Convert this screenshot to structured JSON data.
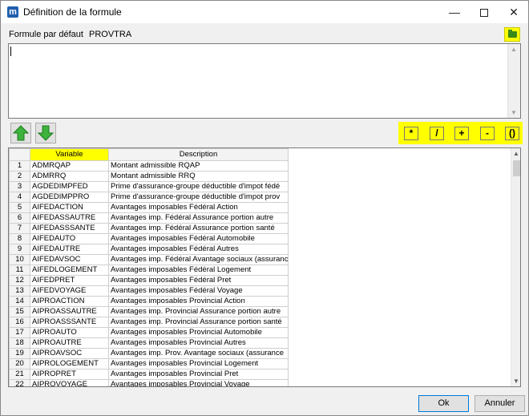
{
  "window": {
    "app_icon_letter": "m",
    "title": "Définition de la formule",
    "controls": {
      "minimize": "—",
      "close": "✕"
    }
  },
  "formula": {
    "label": "Formule par défaut",
    "name": "PROVTRA",
    "content": ""
  },
  "operators": [
    "*",
    "/",
    "+",
    "-",
    "()"
  ],
  "grid": {
    "columns": [
      "Variable",
      "Description"
    ],
    "rows": [
      {
        "n": "1",
        "variable": "ADMRQAP",
        "description": "Montant admissible RQAP"
      },
      {
        "n": "2",
        "variable": "ADMRRQ",
        "description": "Montant admissible RRQ"
      },
      {
        "n": "3",
        "variable": "AGDEDIMPFED",
        "description": "Prime d'assurance-groupe déductible d'impot fédé"
      },
      {
        "n": "4",
        "variable": "AGDEDIMPPRO",
        "description": "Prime d'assurance-groupe déductible d'impot prov"
      },
      {
        "n": "5",
        "variable": "AIFEDACTION",
        "description": "Avantages imposables Fédéral    Action"
      },
      {
        "n": "6",
        "variable": "AIFEDASSAUTRE",
        "description": "Avantages imp. Fédéral    Assurance portion autre"
      },
      {
        "n": "7",
        "variable": "AIFEDASSSANTE",
        "description": "Avantages imp. Fédéral    Assurance portion santé"
      },
      {
        "n": "8",
        "variable": "AIFEDAUTO",
        "description": "Avantages imposables Fédéral    Automobile"
      },
      {
        "n": "9",
        "variable": "AIFEDAUTRE",
        "description": "Avantages imposables Fédéral    Autres"
      },
      {
        "n": "10",
        "variable": "AIFEDAVSOC",
        "description": "Avantages imp. Fédéral Avantage sociaux (assuranc"
      },
      {
        "n": "11",
        "variable": "AIFEDLOGEMENT",
        "description": "Avantages imposables Fédéral    Logement"
      },
      {
        "n": "12",
        "variable": "AIFEDPRET",
        "description": "Avantages imposables Fédéral    Pret"
      },
      {
        "n": "13",
        "variable": "AIFEDVOYAGE",
        "description": "Avantages imposables Fédéral    Voyage"
      },
      {
        "n": "14",
        "variable": "AIPROACTION",
        "description": "Avantages imposables Provincial Action"
      },
      {
        "n": "15",
        "variable": "AIPROASSAUTRE",
        "description": "Avantages imp. Provincial Assurance portion autre"
      },
      {
        "n": "16",
        "variable": "AIPROASSSANTE",
        "description": "Avantages imp. Provincial Assurance portion santé"
      },
      {
        "n": "17",
        "variable": "AIPROAUTO",
        "description": "Avantages imposables Provincial Automobile"
      },
      {
        "n": "18",
        "variable": "AIPROAUTRE",
        "description": "Avantages imposables Provincial Autres"
      },
      {
        "n": "19",
        "variable": "AIPROAVSOC",
        "description": "Avantages imp. Prov.   Avantage sociaux (assurance"
      },
      {
        "n": "20",
        "variable": "AIPROLOGEMENT",
        "description": "Avantages imposables Provincial Logement"
      },
      {
        "n": "21",
        "variable": "AIPROPRET",
        "description": "Avantages imposables Provincial Pret"
      },
      {
        "n": "22",
        "variable": "AIPROVOYAGE",
        "description": "Avantages imposables Provincial Voyage"
      }
    ]
  },
  "buttons": {
    "ok": "Ok",
    "cancel": "Annuler"
  },
  "colors": {
    "highlight": "#ffff00",
    "arrow_green": "#3db33d",
    "accent_border": "#0078d7"
  },
  "icons": [
    "app-icon",
    "folder-icon",
    "arrow-up-icon",
    "arrow-down-icon"
  ]
}
